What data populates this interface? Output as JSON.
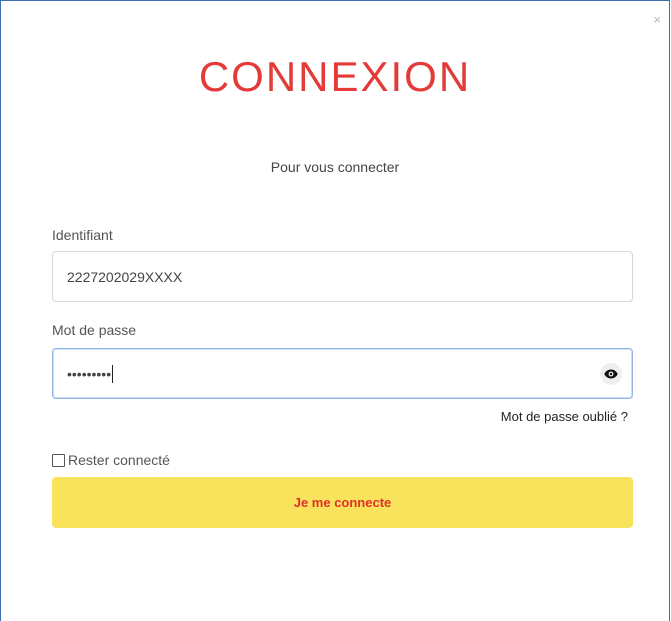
{
  "dialog": {
    "close_label": "×",
    "title": "CONNEXION",
    "subtitle": "Pour vous connecter"
  },
  "form": {
    "identifier": {
      "label": "Identifiant",
      "value": "2227202029XXXX"
    },
    "password": {
      "label": "Mot de passe",
      "masked_value": "•••••••••",
      "toggle_icon": "eye-icon"
    },
    "forgot_link": "Mot de passe oublié ?",
    "remember_me": {
      "label": "Rester connecté",
      "checked": false
    },
    "submit_label": "Je me connecte"
  },
  "colors": {
    "title": "#e23b38",
    "button_bg": "#f9e35d",
    "button_text": "#e0302b",
    "focus_border": "#8fb6e6"
  }
}
